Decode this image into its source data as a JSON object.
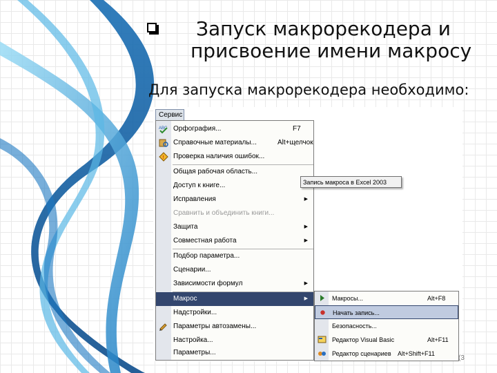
{
  "slide": {
    "title_line1": "Запуск макрорекодера и",
    "title_line2": "присвоение имени макросу",
    "subtitle": "Для запуска макрорекодера необходимо:",
    "page_marker": "(3"
  },
  "menubar": {
    "active_menu": "Сервис"
  },
  "menu": {
    "items": [
      {
        "label": "Орфография...",
        "shortcut": "F7",
        "icon": "spellcheck-icon"
      },
      {
        "label": "Справочные материалы...",
        "shortcut": "Alt+щелчок",
        "icon": "research-icon"
      },
      {
        "label": "Проверка наличия ошибок...",
        "icon": "error-check-icon"
      },
      {
        "label": "Общая рабочая область..."
      },
      {
        "label": "Доступ к книге..."
      },
      {
        "label": "Исправления",
        "submenu": true
      },
      {
        "label": "Сравнить и объединить книги...",
        "disabled": true
      },
      {
        "label": "Защита",
        "submenu": true
      },
      {
        "label": "Совместная работа",
        "submenu": true
      },
      {
        "label": "Подбор параметра..."
      },
      {
        "label": "Сценарии..."
      },
      {
        "label": "Зависимости формул",
        "submenu": true
      },
      {
        "label": "Макрос",
        "submenu": true,
        "highlighted": true
      },
      {
        "label": "Надстройки..."
      },
      {
        "label": "Параметры автозамены...",
        "icon": "autocorrect-icon"
      },
      {
        "label": "Настройка..."
      },
      {
        "label": "Параметры..."
      }
    ]
  },
  "tooltip": {
    "text": "Запись макроса в Excel 2003"
  },
  "submenu": {
    "items": [
      {
        "label": "Макросы...",
        "shortcut": "Alt+F8",
        "icon": "macro-play-icon"
      },
      {
        "label": "Начать запись...",
        "icon": "record-icon",
        "highlighted": true
      },
      {
        "label": "Безопасность..."
      },
      {
        "label": "Редактор Visual Basic",
        "shortcut": "Alt+F11",
        "icon": "vba-editor-icon"
      },
      {
        "label": "Редактор сценариев",
        "shortcut": "Alt+Shift+F11",
        "icon": "script-editor-icon"
      }
    ]
  },
  "colors": {
    "highlight": "#33466e",
    "swirl_dark": "#1565a8",
    "swirl_light": "#6cc4ea"
  }
}
